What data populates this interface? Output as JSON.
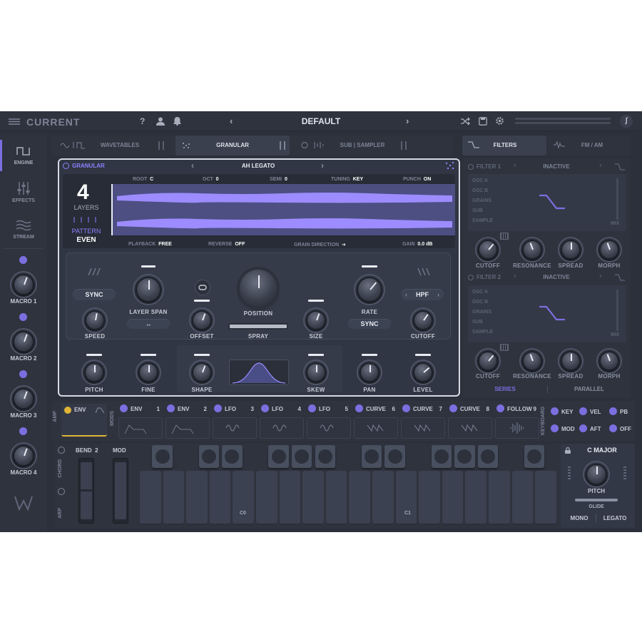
{
  "app": {
    "logo_text": "CURRENT",
    "preset_name": "DEFAULT"
  },
  "header": {
    "help_label": "?"
  },
  "sidebar": {
    "items": [
      {
        "label": "ENGINE"
      },
      {
        "label": "EFFECTS"
      },
      {
        "label": "STREAM"
      }
    ],
    "macros": [
      "MACRO 1",
      "MACRO 2",
      "MACRO 3",
      "MACRO 4"
    ]
  },
  "tabs": {
    "left": [
      "WAVETABLES",
      "GRANULAR",
      "SUB | SAMPLER"
    ],
    "right": [
      "FILTERS",
      "FM / AM"
    ]
  },
  "granular": {
    "title": "GRANULAR",
    "patch": "AH LEGATO",
    "root_label": "ROOT",
    "root_value": "C",
    "oct_label": "OCT",
    "oct_value": "0",
    "semi_label": "SEMI",
    "semi_value": "0",
    "tuning_label": "TUNING",
    "tuning_value": "KEY",
    "punch_label": "PUNCH",
    "punch_value": "ON",
    "layers_count": "4",
    "layers_label": "LAYERS",
    "pattern_label": "PATTERN",
    "pattern_value": "EVEN",
    "playback_label": "PLAYBACK",
    "playback_value": "FREE",
    "reverse_label": "REVERSE",
    "reverse_value": "OFF",
    "grain_direction_label": "GRAIN DIRECTION",
    "grain_direction_value": "➔",
    "gain_label": "GAIN",
    "gain_value": "0.0 dB",
    "sync_button": "SYNC",
    "layer_span_label": "LAYER SPAN",
    "layer_span_button": "↔",
    "position_label": "POSITION",
    "rate_label": "RATE",
    "rate_sync_button": "SYNC",
    "hpf_label": "HPF",
    "speed_label": "SPEED",
    "offset_label": "OFFSET",
    "spray_label": "SPRAY",
    "size_label": "SIZE",
    "cutoff_label": "CUTOFF",
    "pitch_label": "PITCH",
    "fine_label": "FINE",
    "shape_label": "SHAPE",
    "skew_label": "SKEW",
    "pan_label": "PAN",
    "level_label": "LEVEL"
  },
  "filters": [
    {
      "name": "FILTER 1",
      "state": "INACTIVE",
      "sources": [
        "OSC A",
        "OSC B",
        "GRAINS",
        "SUB",
        "SAMPLE"
      ],
      "mix_label": "MIX",
      "knobs": [
        "CUTOFF",
        "RESONANCE",
        "SPREAD",
        "MORPH"
      ]
    },
    {
      "name": "FILTER 2",
      "state": "INACTIVE",
      "sources": [
        "OSC A",
        "OSC B",
        "GRAINS",
        "SUB",
        "SAMPLE"
      ],
      "mix_label": "MIX",
      "knobs": [
        "CUTOFF",
        "RESONANCE",
        "SPREAD",
        "MORPH"
      ]
    }
  ],
  "routing": {
    "series": "SERIES",
    "parallel": "PARALLEL"
  },
  "mods": {
    "amp_label": "AMP",
    "mods_label": "MODS",
    "amp_env": "ENV",
    "items": [
      {
        "type": "ENV",
        "num": "1"
      },
      {
        "type": "ENV",
        "num": "2"
      },
      {
        "type": "LFO",
        "num": "3"
      },
      {
        "type": "LFO",
        "num": "4"
      },
      {
        "type": "LFO",
        "num": "5"
      },
      {
        "type": "CURVE",
        "num": "6"
      },
      {
        "type": "CURVE",
        "num": "7"
      },
      {
        "type": "CURVE",
        "num": "8"
      },
      {
        "type": "FOLLOW",
        "num": "9"
      }
    ]
  },
  "keyboard_mods": {
    "label": "KEYBOARD",
    "items": [
      "KEY",
      "VEL",
      "PB",
      "MOD",
      "AFT",
      "OFF"
    ]
  },
  "keyboard": {
    "bend_label": "BEND",
    "bend_value": "2",
    "mod_label": "MOD",
    "chord_label": "CHORD",
    "arp_label": "ARP",
    "c0": "C0",
    "c1": "C1",
    "scale": "C  MAJOR",
    "pitch_label": "PITCH",
    "glide_label": "GLIDE",
    "mono": "MONO",
    "legato": "LEGATO"
  },
  "colors": {
    "accent": "#7b6fe0",
    "background": "#2b303b",
    "panel": "#323846"
  }
}
